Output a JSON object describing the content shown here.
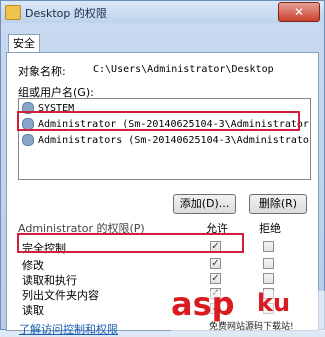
{
  "window": {
    "title": "Desktop 的权限",
    "close_glyph": "✕"
  },
  "tab": {
    "label": "安全"
  },
  "object": {
    "label": "对象名称:",
    "value": "C:\\Users\\Administrator\\Desktop"
  },
  "groups": {
    "label": "组或用户名(G):",
    "items": [
      {
        "name": "SYSTEM"
      },
      {
        "name": "Administrator (Sm-20140625104‑3\\Administrator)"
      },
      {
        "name": "Administrators (Sm-20140625104‑3\\Administrators)"
      }
    ]
  },
  "buttons": {
    "add": "添加(D)...",
    "remove": "删除(R)"
  },
  "permissions": {
    "header": "Administrator 的权限(P)",
    "allow": "允许",
    "deny": "拒绝",
    "items": [
      {
        "label": "完全控制",
        "allow": "✓",
        "deny": ""
      },
      {
        "label": "修改",
        "allow": "✓",
        "deny": ""
      },
      {
        "label": "读取和执行",
        "allow": "✓",
        "deny": ""
      },
      {
        "label": "列出文件夹内容",
        "allow": "✓",
        "deny": ""
      },
      {
        "label": "读取",
        "allow": "✓",
        "deny": ""
      }
    ]
  },
  "link": "了解访问控制和权限",
  "watermark": {
    "brand": "asp",
    "brand2": "ku",
    "sub": "免费网站源码下载站!"
  }
}
